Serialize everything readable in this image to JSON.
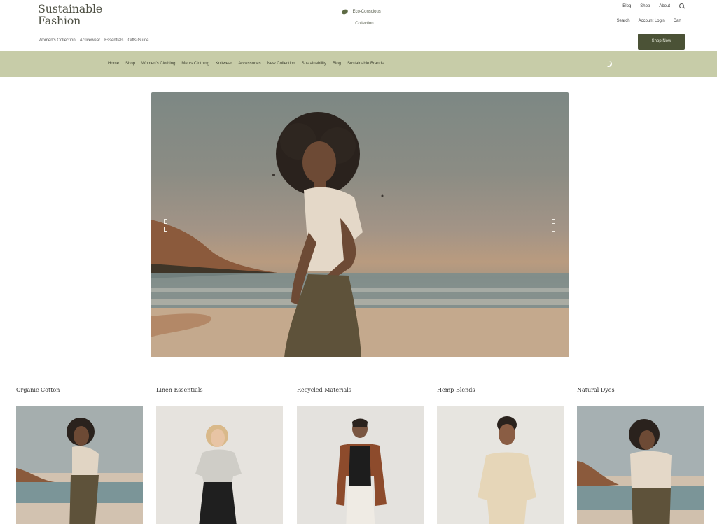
{
  "header": {
    "logo_line1": "Sustainable",
    "logo_line2": "Fashion",
    "tagline": "Eco-Conscious",
    "tagline_sub": "Collection",
    "util_nav": [
      "Blog",
      "Shop",
      "About"
    ],
    "account_nav": [
      "Search",
      "Account Login",
      "Cart"
    ]
  },
  "subbar": {
    "crumbs": [
      "Women's Collection",
      "Activewear",
      "Essentials",
      "Gifts Guide"
    ],
    "cta_label": "Shop Now"
  },
  "main_nav": {
    "items": [
      "Home",
      "Shop",
      "Women's Clothing",
      "Men's Clothing",
      "Knitwear",
      "Accessories",
      "New Collection",
      "Sustainability",
      "Blog",
      "Sustainable Brands"
    ]
  },
  "hero": {
    "alt": "Woman standing on a beach at sunset"
  },
  "categories": [
    {
      "title": "Organic Cotton"
    },
    {
      "title": "Linen Essentials"
    },
    {
      "title": "Recycled Materials"
    },
    {
      "title": "Hemp Blends"
    },
    {
      "title": "Natural Dyes"
    }
  ],
  "colors": {
    "nav_background": "#c7cca8",
    "cta_background": "#4b5236",
    "logo_text": "#4f5145"
  }
}
